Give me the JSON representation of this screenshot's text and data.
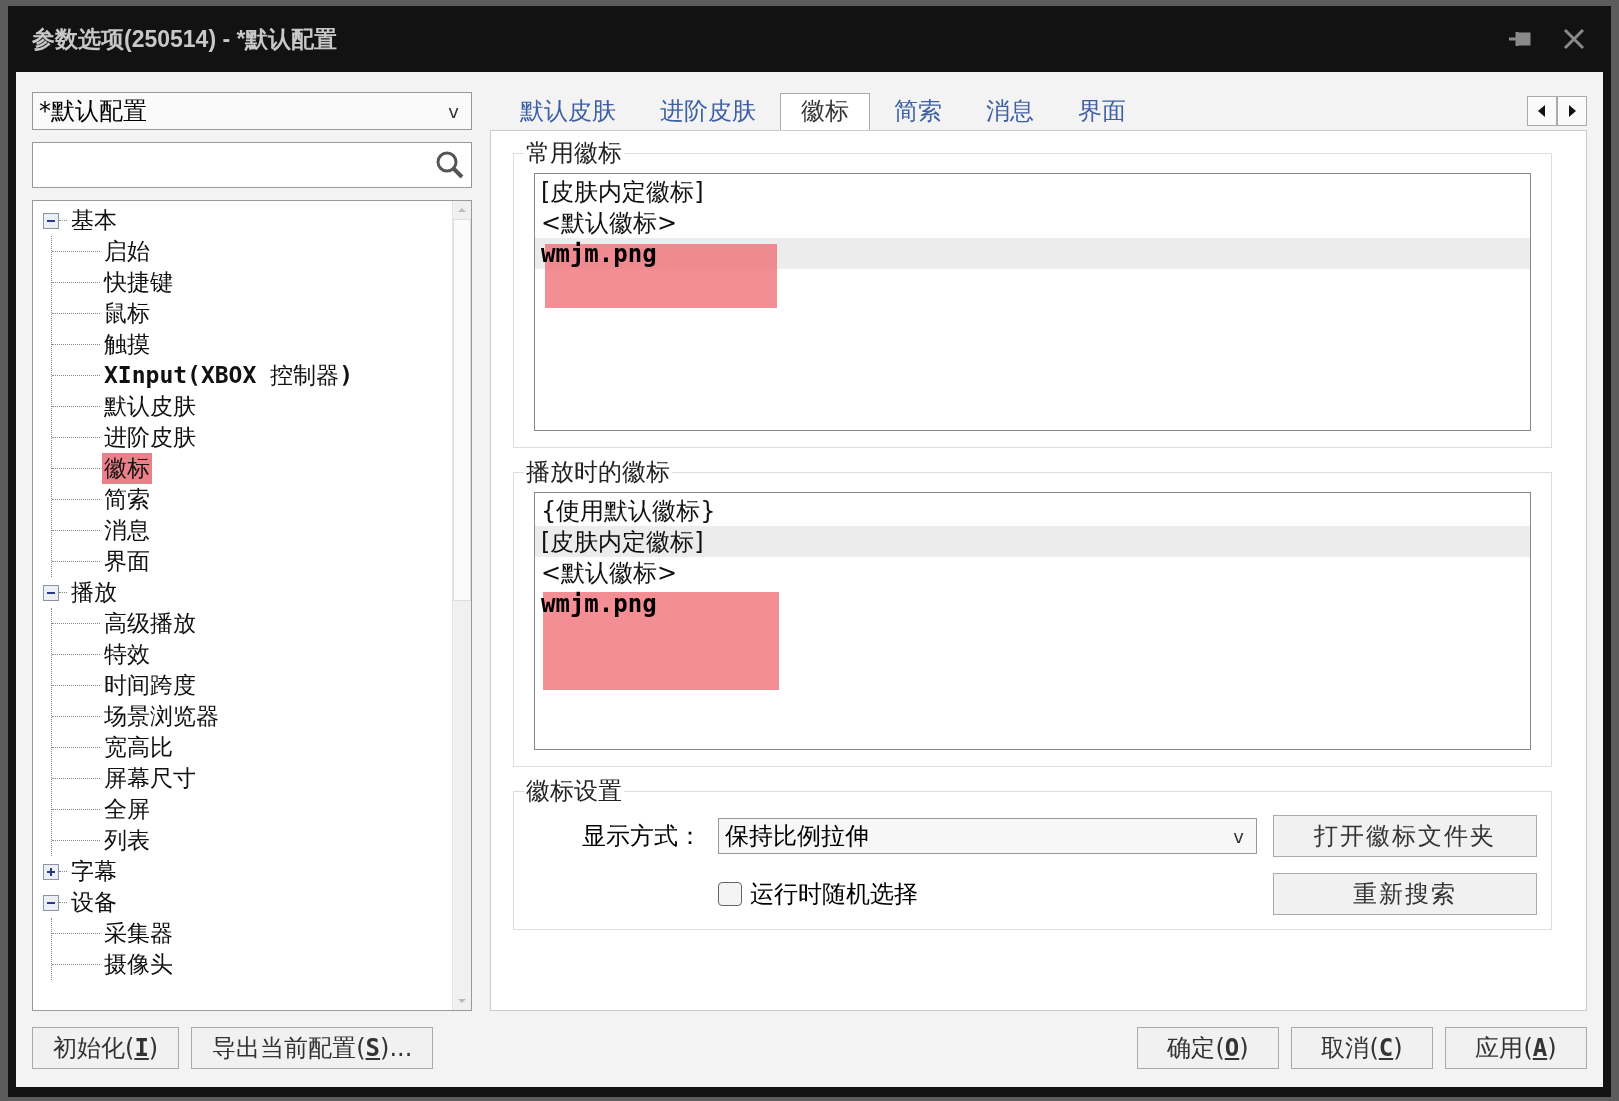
{
  "window": {
    "title": "参数选项(250514) - *默认配置"
  },
  "profile_select": {
    "value": "*默认配置",
    "caret": "v"
  },
  "tree": [
    {
      "label": "基本",
      "expanded": true,
      "selected": false,
      "children": [
        {
          "label": "启始",
          "selected": false
        },
        {
          "label": "快捷键",
          "selected": false
        },
        {
          "label": "鼠标",
          "selected": false
        },
        {
          "label": "触摸",
          "selected": false
        },
        {
          "label": "**XInput(XBOX** 控制器**)**",
          "selected": false
        },
        {
          "label": "默认皮肤",
          "selected": false
        },
        {
          "label": "进阶皮肤",
          "selected": false
        },
        {
          "label": "徽标",
          "selected": true
        },
        {
          "label": "简索",
          "selected": false
        },
        {
          "label": "消息",
          "selected": false
        },
        {
          "label": "界面",
          "selected": false
        }
      ]
    },
    {
      "label": "播放",
      "expanded": true,
      "selected": false,
      "children": [
        {
          "label": "高级播放",
          "selected": false
        },
        {
          "label": "特效",
          "selected": false
        },
        {
          "label": "时间跨度",
          "selected": false
        },
        {
          "label": "场景浏览器",
          "selected": false
        },
        {
          "label": "宽高比",
          "selected": false
        },
        {
          "label": "屏幕尺寸",
          "selected": false
        },
        {
          "label": "全屏",
          "selected": false
        },
        {
          "label": "列表",
          "selected": false
        }
      ]
    },
    {
      "label": "字幕",
      "expanded": false,
      "selected": false
    },
    {
      "label": "设备",
      "expanded": true,
      "selected": false,
      "children": [
        {
          "label": "采集器",
          "selected": false
        },
        {
          "label": "摄像头",
          "selected": false
        }
      ]
    }
  ],
  "tabs": [
    {
      "label": "默认皮肤",
      "selected": false
    },
    {
      "label": "进阶皮肤",
      "selected": false
    },
    {
      "label": "徽标",
      "selected": true
    },
    {
      "label": "简索",
      "selected": false
    },
    {
      "label": "消息",
      "selected": false
    },
    {
      "label": "界面",
      "selected": false
    }
  ],
  "groups": [
    {
      "title": "常用徽标",
      "items": [
        {
          "label": "[皮肤内定徽标]",
          "kind": "builtin",
          "selected": false,
          "marked": false
        },
        {
          "label": "<默认徽标>",
          "kind": "builtin",
          "selected": false,
          "marked": false
        },
        {
          "label": "wmjm.png",
          "kind": "file",
          "selected": true,
          "marked": true
        }
      ]
    },
    {
      "title": "播放时的徽标",
      "items": [
        {
          "label": "{使用默认徽标}",
          "kind": "builtin",
          "selected": false,
          "marked": false
        },
        {
          "label": "[皮肤内定徽标]",
          "kind": "builtin",
          "selected": true,
          "marked": false
        },
        {
          "label": "<默认徽标>",
          "kind": "builtin",
          "selected": false,
          "marked": false
        },
        {
          "label": "wmjm.png",
          "kind": "file",
          "selected": false,
          "marked": true
        }
      ]
    }
  ],
  "logo_settings": {
    "title": "徽标设置",
    "display_label": "显示方式：",
    "display_value": "保持比例拉伸",
    "display_caret": "v",
    "random_checkbox": {
      "label": "运行时随机选择",
      "checked": false
    },
    "buttons": [
      "打开徽标文件夹",
      "重新搜索"
    ]
  },
  "footer_left": [
    {
      "before": "初始化(",
      "key": "I",
      "after": ")"
    },
    {
      "before": "导出当前配置(",
      "key": "S",
      "after": ")..."
    }
  ],
  "footer_right": [
    {
      "before": "确定(",
      "key": "O",
      "after": ")"
    },
    {
      "before": "取消(",
      "key": "C",
      "after": ")"
    },
    {
      "before": "应用(",
      "key": "A",
      "after": ")"
    }
  ]
}
